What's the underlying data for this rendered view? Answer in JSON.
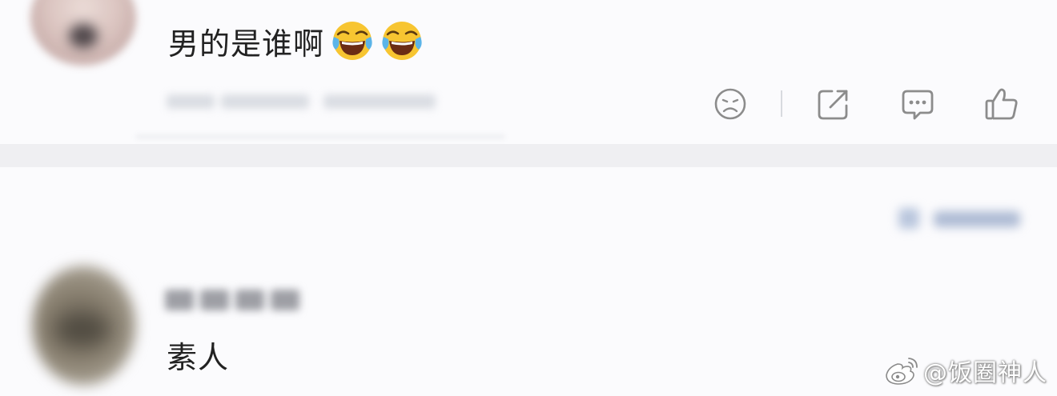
{
  "comments": [
    {
      "text": "男的是谁啊",
      "emojis": [
        "tears-of-joy-emoji",
        "tears-of-joy-emoji"
      ],
      "actions": [
        "sad-face-icon",
        "share-icon",
        "comment-icon",
        "like-icon"
      ]
    },
    {
      "text": "素人"
    }
  ],
  "watermark": {
    "text": "@饭圈神人",
    "icon": "weibo-logo-icon"
  },
  "colors": {
    "background": "#fbfbfd",
    "separator": "#efeff2",
    "text": "#222222",
    "icon": "#8c8c8c"
  }
}
